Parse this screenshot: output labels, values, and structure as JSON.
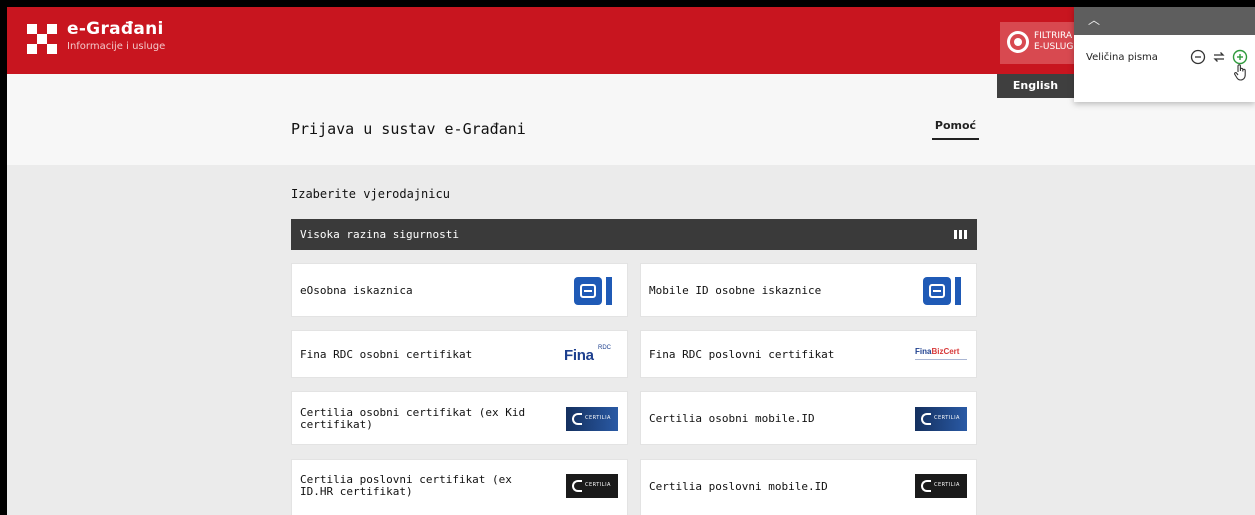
{
  "header": {
    "brand_title": "e-Građani",
    "brand_subtitle": "Informacije i usluge",
    "filter_label_line1": "FILTRIRA",
    "filter_label_line2": "E-USLUG",
    "language_button": "English",
    "accent_color": "#c8151f"
  },
  "font_size_popup": {
    "label": "Veličina pisma",
    "collapse_icon": "chevron-up-icon",
    "decrease_icon": "minus-circle-icon",
    "reset_icon": "reset-arrows-icon",
    "increase_icon": "plus-circle-icon"
  },
  "page": {
    "title": "Prijava u sustav e-Građani",
    "help_link": "Pomoć",
    "section_title": "Izaberite vjerodajnicu"
  },
  "security_level": {
    "label": "Visoka razina sigurnosti",
    "icon": "signal-bars-icon"
  },
  "credentials": [
    {
      "label": "eOsobna iskaznica",
      "logo": "eid-logo"
    },
    {
      "label": "Mobile ID osobne iskaznice",
      "logo": "eid-logo"
    },
    {
      "label": "Fina RDC osobni certifikat",
      "logo": "fina-rdc-logo",
      "logo_text": "Fina",
      "logo_sup": "RDC"
    },
    {
      "label": "Fina RDC poslovni certifikat",
      "logo": "fina-bizcert-logo",
      "logo_text": "Fina",
      "logo_text_accent": "BizCert"
    },
    {
      "label": "Certilia osobni certifikat (ex Kid certifikat)",
      "logo": "certilia-logo-blue",
      "logo_text": "CERTILIA"
    },
    {
      "label": "Certilia osobni mobile.ID",
      "logo": "certilia-logo-blue",
      "logo_text": "CERTILIA"
    },
    {
      "label": "Certilia poslovni certifikat (ex ID.HR certifikat)",
      "logo": "certilia-logo-dark",
      "logo_text": "CERTILIA"
    },
    {
      "label": "Certilia poslovni mobile.ID",
      "logo": "certilia-logo-dark",
      "logo_text": "CERTILIA"
    }
  ]
}
